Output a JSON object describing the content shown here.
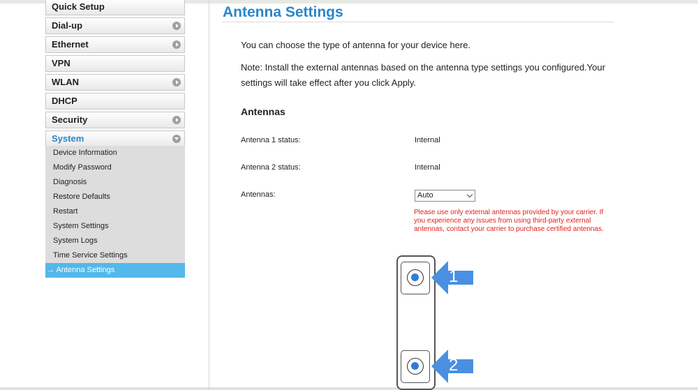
{
  "sidebar": {
    "items": [
      {
        "label": "Quick Setup",
        "has_arrow": false
      },
      {
        "label": "Dial-up",
        "has_arrow": true
      },
      {
        "label": "Ethernet",
        "has_arrow": true
      },
      {
        "label": "VPN",
        "has_arrow": false
      },
      {
        "label": "WLAN",
        "has_arrow": true
      },
      {
        "label": "DHCP",
        "has_arrow": false
      },
      {
        "label": "Security",
        "has_arrow": true
      },
      {
        "label": "System",
        "has_arrow": true,
        "expanded": true
      }
    ],
    "submenu": [
      {
        "label": "Device Information"
      },
      {
        "label": "Modify Password"
      },
      {
        "label": "Diagnosis"
      },
      {
        "label": "Restore Defaults"
      },
      {
        "label": "Restart"
      },
      {
        "label": "System Settings"
      },
      {
        "label": "System Logs"
      },
      {
        "label": "Time Service Settings"
      },
      {
        "label": "Antenna Settings",
        "selected": true,
        "prefix": "→"
      }
    ],
    "colors": {
      "active_text": "#2a86c8",
      "selected_bg": "#53b8ea",
      "submenu_bg": "#dddddd"
    }
  },
  "main": {
    "title": "Antenna Settings",
    "description": "You can choose the type of antenna for your device here.",
    "note_line1": "Note: Install the external antennas based on the antenna type settings you configured.Your",
    "note_line2": "settings will take effect after you click Apply.",
    "section_title": "Antennas",
    "fields": [
      {
        "label": "Antenna 1 status:",
        "value": "Internal"
      },
      {
        "label": "Antenna 2 status:",
        "value": "Internal"
      }
    ],
    "antennas_select": {
      "label": "Antennas:",
      "value": "Auto"
    },
    "warning": "Please use only external antennas provided by your carrier. If you experience any issues from using third-party external antennas, contact your carrier to purchase certified antennas.",
    "warning_color": "#e0201b"
  },
  "diagram": {
    "callouts": [
      "1",
      "2"
    ],
    "arrow_color": "#4a90e2",
    "port_color": "#2f7dd6"
  }
}
